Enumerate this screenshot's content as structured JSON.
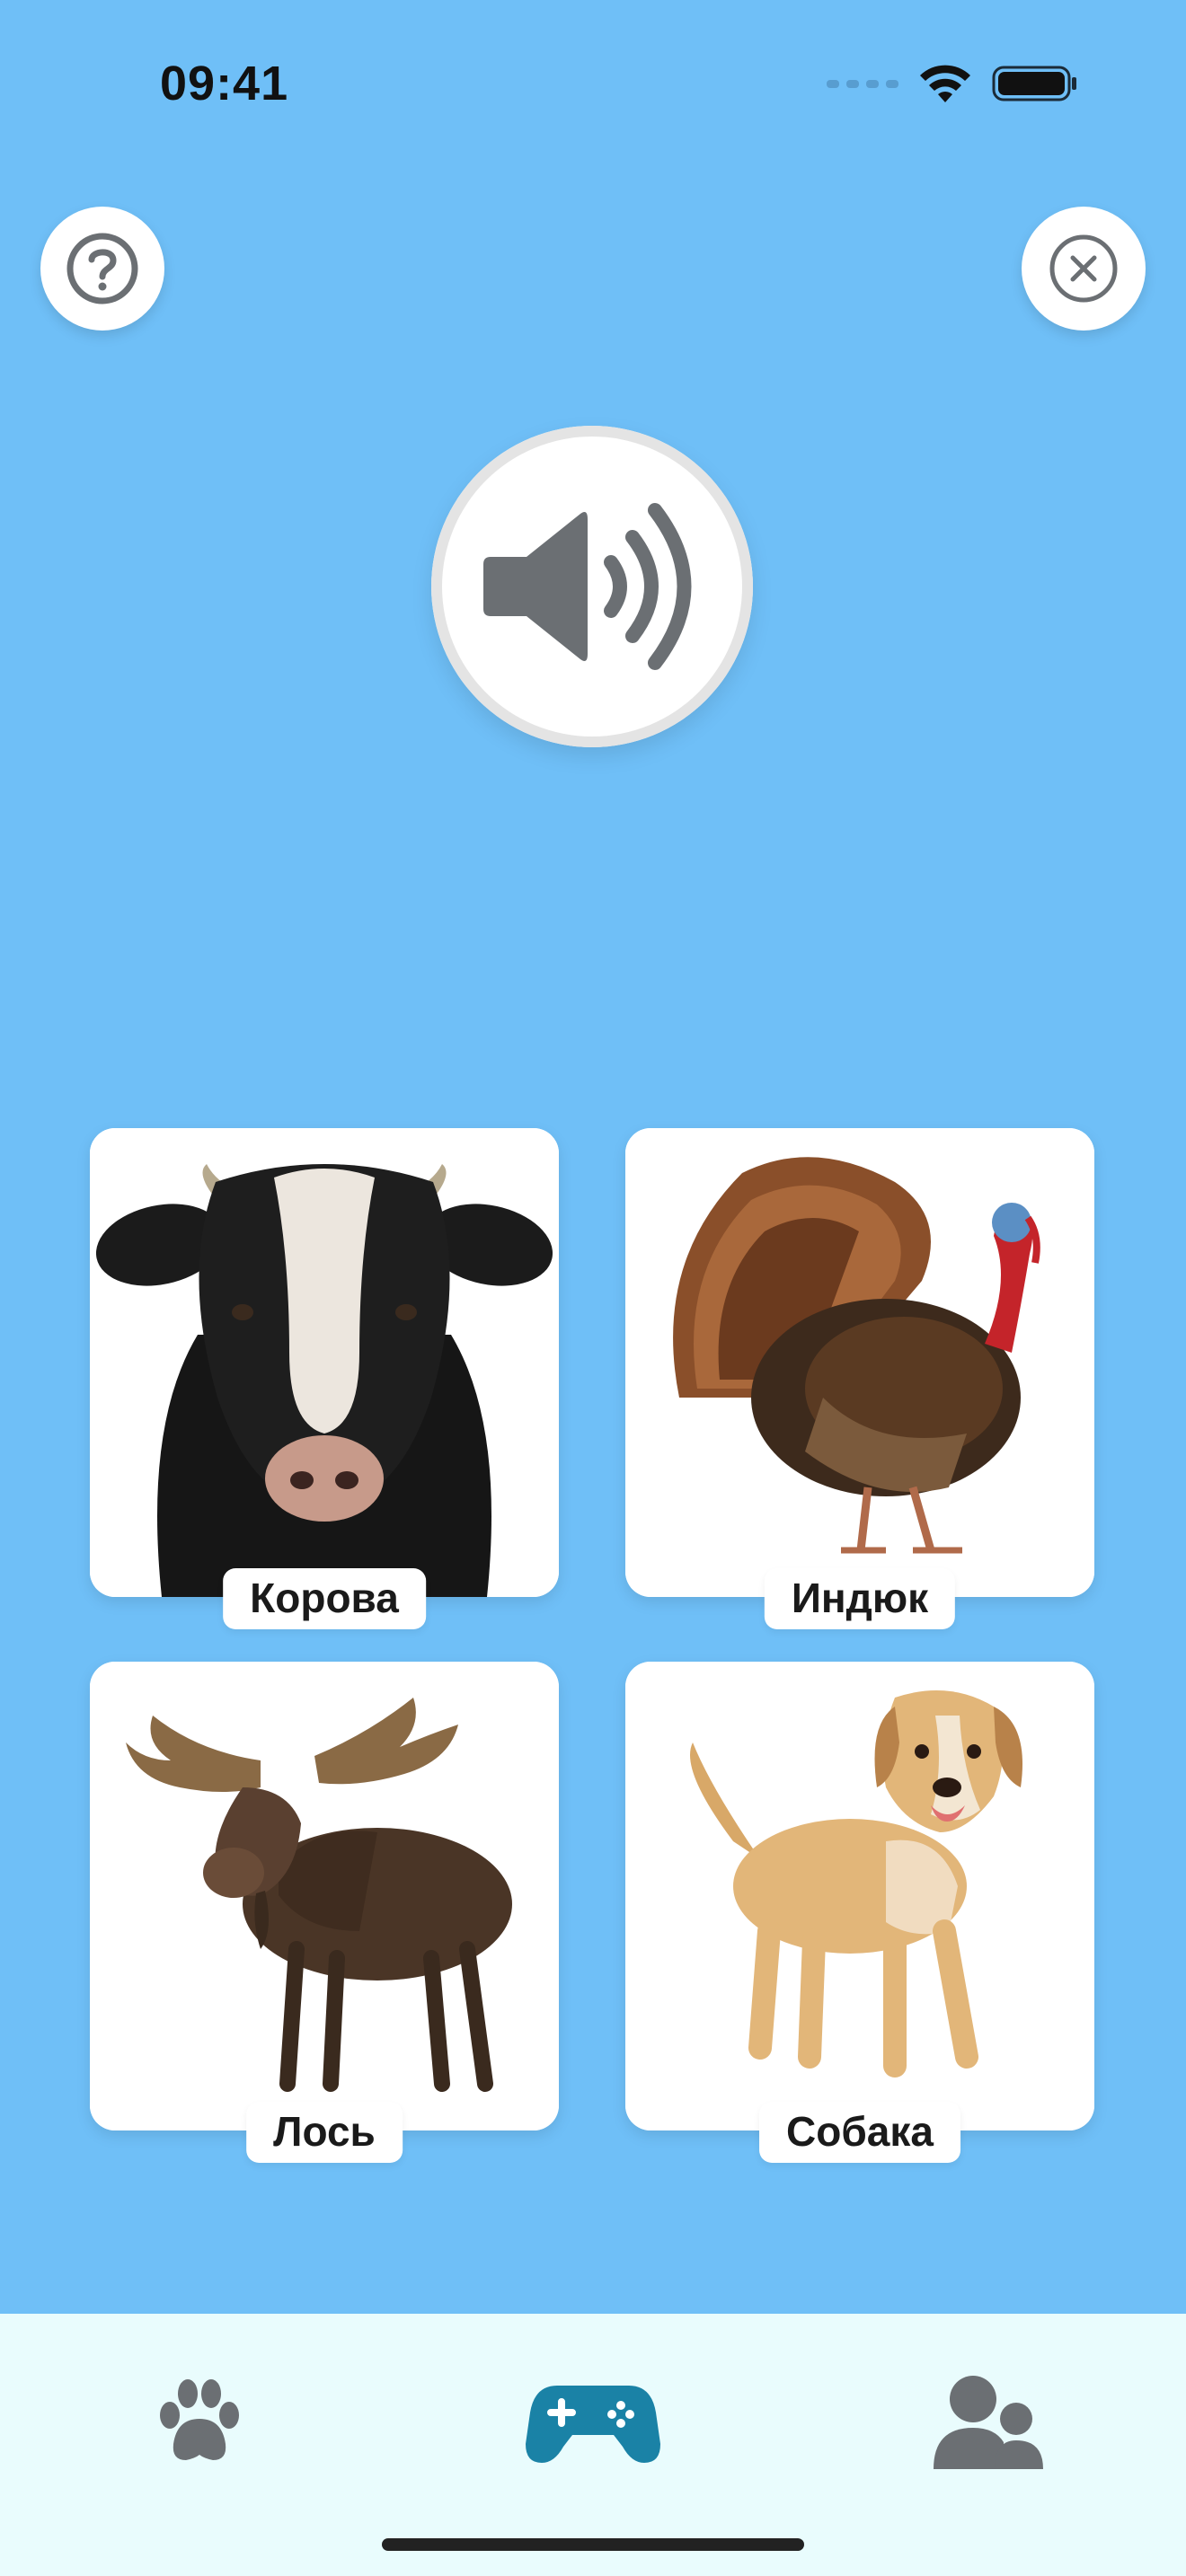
{
  "status_bar": {
    "time": "09:41"
  },
  "buttons": {
    "help_icon": "question-circle-icon",
    "close_icon": "x-circle-icon",
    "speaker_icon": "speaker-wave-icon"
  },
  "cards": [
    {
      "label": "Корова",
      "icon": "cow"
    },
    {
      "label": "Индюк",
      "icon": "turkey"
    },
    {
      "label": "Лось",
      "icon": "moose"
    },
    {
      "label": "Собака",
      "icon": "dog"
    }
  ],
  "tab_bar": {
    "items": [
      {
        "icon": "paw-icon",
        "active": false
      },
      {
        "icon": "gamepad-icon",
        "active": true
      },
      {
        "icon": "users-icon",
        "active": false
      }
    ]
  },
  "colors": {
    "background": "#6fbff7",
    "tab_bar": "#e9fcfd",
    "active_tab": "#1a82a6",
    "inactive_tab": "#6b6f73",
    "icon_gray": "#6b6f73"
  }
}
